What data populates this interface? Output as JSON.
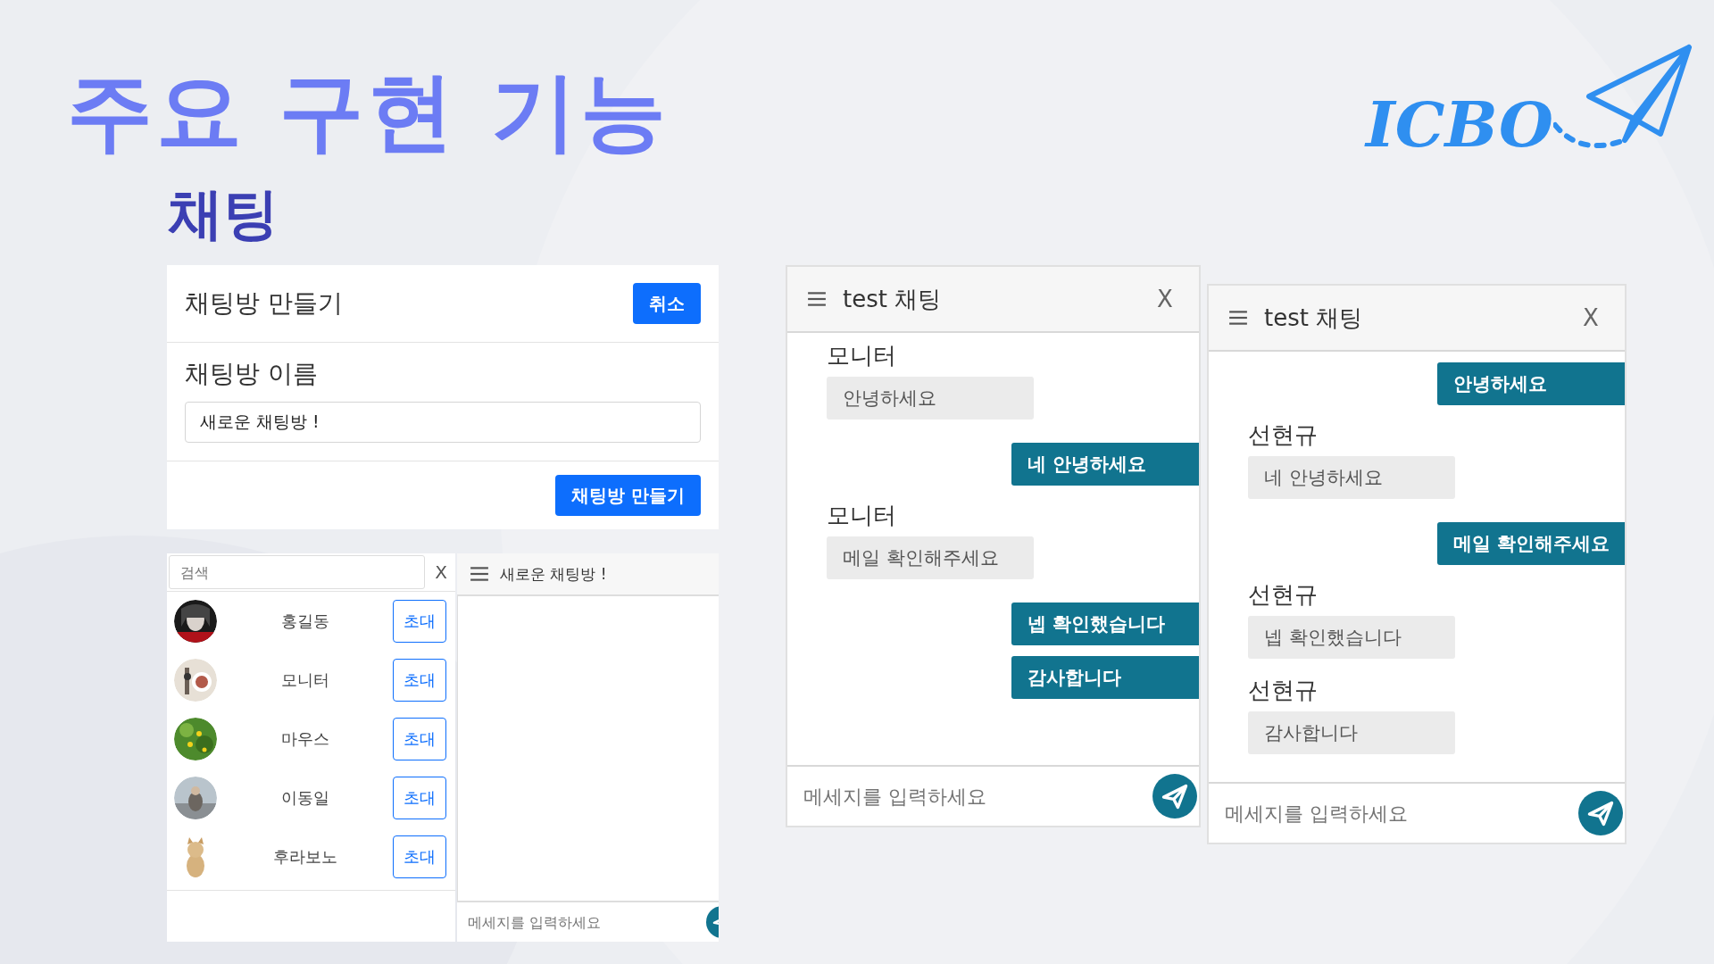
{
  "slide": {
    "title": "주요 구현 기능",
    "subtitle": "채팅",
    "logo_text": "ICBO"
  },
  "create_room": {
    "title": "채팅방 만들기",
    "cancel_button": "취소",
    "name_label": "채팅방 이름",
    "name_value": "새로운 채팅방 !",
    "create_button": "채팅방 만들기"
  },
  "invite": {
    "search_placeholder": "검색",
    "clear_button": "X",
    "users": [
      {
        "name": "홍길동",
        "button": "초대"
      },
      {
        "name": "모니터",
        "button": "초대"
      },
      {
        "name": "마우스",
        "button": "초대"
      },
      {
        "name": "이동일",
        "button": "초대"
      },
      {
        "name": "후라보노",
        "button": "초대"
      }
    ],
    "chat_title": "새로운 채팅방 !",
    "message_placeholder": "메세지를 입력하세요"
  },
  "chats": [
    {
      "title": "test 채팅",
      "close_button": "X",
      "message_placeholder": "메세지를 입력하세요",
      "messages": [
        {
          "kind": "received",
          "sender": "모니터",
          "text": "안녕하세요"
        },
        {
          "kind": "sent",
          "text": "네 안녕하세요"
        },
        {
          "kind": "received",
          "sender": "모니터",
          "text": "메일 확인해주세요"
        },
        {
          "kind": "sent",
          "text": "넵 확인했습니다"
        },
        {
          "kind": "sent",
          "text": "감사합니다"
        }
      ]
    },
    {
      "title": "test 채팅",
      "close_button": "X",
      "message_placeholder": "메세지를 입력하세요",
      "messages": [
        {
          "kind": "sent",
          "text": "안녕하세요"
        },
        {
          "kind": "received",
          "sender": "선현규",
          "text": "네 안녕하세요"
        },
        {
          "kind": "sent",
          "text": "메일 확인해주세요"
        },
        {
          "kind": "received",
          "sender": "선현규",
          "text": "넵 확인했습니다"
        },
        {
          "kind": "received",
          "sender": "선현규",
          "text": "감사합니다"
        }
      ]
    }
  ]
}
